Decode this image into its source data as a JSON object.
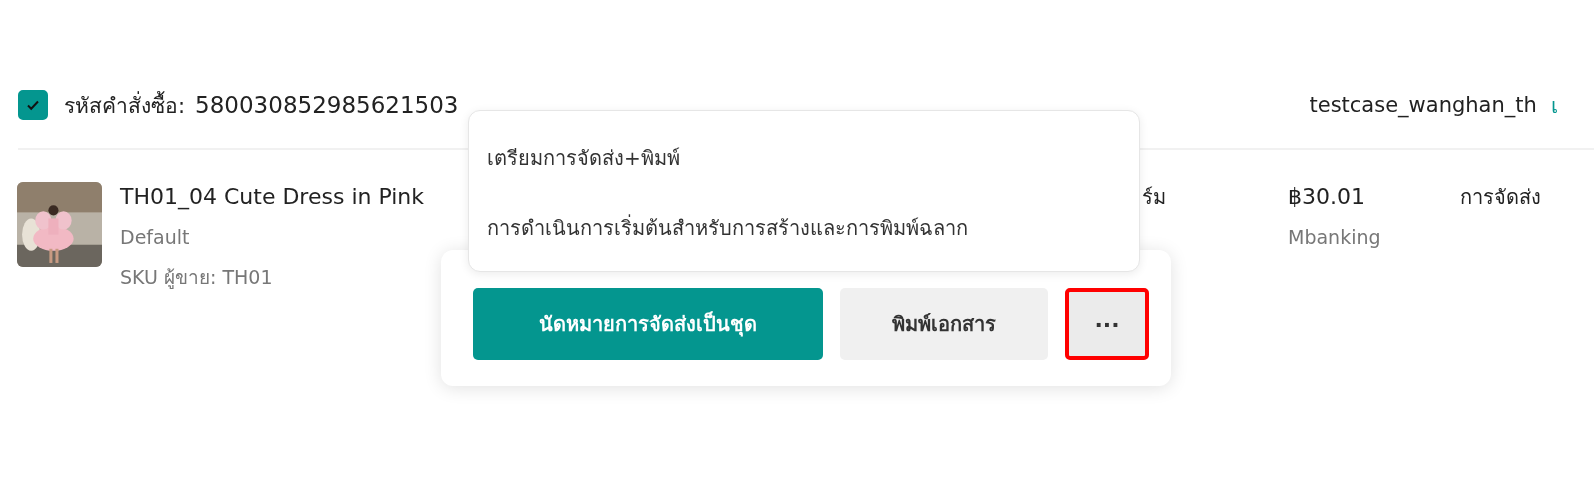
{
  "order": {
    "checked": true,
    "id_label": "รหัสคำสั่งซื้อ:",
    "id": "580030852985621503",
    "buyer": "testcase_wanghan_th",
    "buyer_link": "เ"
  },
  "product": {
    "name": "TH01_04 Cute Dress in Pink",
    "variation": "Default",
    "sku": "SKU ผู้ขาย: TH01",
    "column_3": "ร์ม",
    "price": "฿30.01",
    "payment": "Mbanking",
    "column_5": "การจัดส่ง"
  },
  "menu": {
    "items": [
      {
        "label": "เตรียมการจัดส่ง+พิมพ์"
      },
      {
        "label": "การดำเนินการเริ่มต้นสำหรับการสร้างและการพิมพ์ฉลาก"
      }
    ]
  },
  "actions": [
    {
      "kind": "primary",
      "label": "นัดหมายการจัดส่งเป็นชุด",
      "highlighted": false
    },
    {
      "kind": "secondary",
      "label": "พิมพ์เอกสาร",
      "highlighted": false
    },
    {
      "kind": "more",
      "label": "···",
      "highlighted": true
    }
  ]
}
